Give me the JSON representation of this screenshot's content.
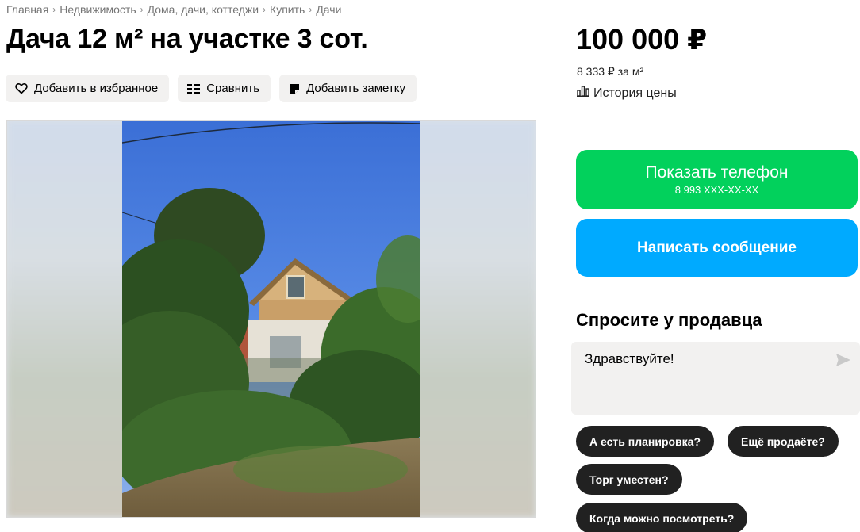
{
  "breadcrumbs": [
    "Главная",
    "Недвижимость",
    "Дома, дачи, коттеджи",
    "Купить",
    "Дачи"
  ],
  "listing": {
    "title": "Дача 12 м² на участке 3 сот.",
    "price": "100 000 ₽",
    "price_per_m2": "8 333 ₽ за м²",
    "price_history": "История цены"
  },
  "actions": {
    "favorite": "Добавить в избранное",
    "compare": "Сравнить",
    "note": "Добавить заметку"
  },
  "contact": {
    "show_phone": "Показать телефон",
    "phone_mask": "8 993 XXX-XX-XX",
    "write_message": "Написать сообщение"
  },
  "ask_seller": {
    "title": "Спросите у продавца",
    "message": "Здравствуйте!",
    "quick_questions": [
      "А есть планировка?",
      "Ещё продаёте?",
      "Торг уместен?",
      "Когда можно посмотреть?"
    ]
  },
  "colors": {
    "phone_button": "#02d15c",
    "message_button": "#00aaff",
    "chip": "#212121",
    "secondary_bg": "#f2f1f0"
  },
  "icons": [
    "heart-icon",
    "compare-icon",
    "note-icon",
    "chart-icon",
    "send-icon"
  ]
}
